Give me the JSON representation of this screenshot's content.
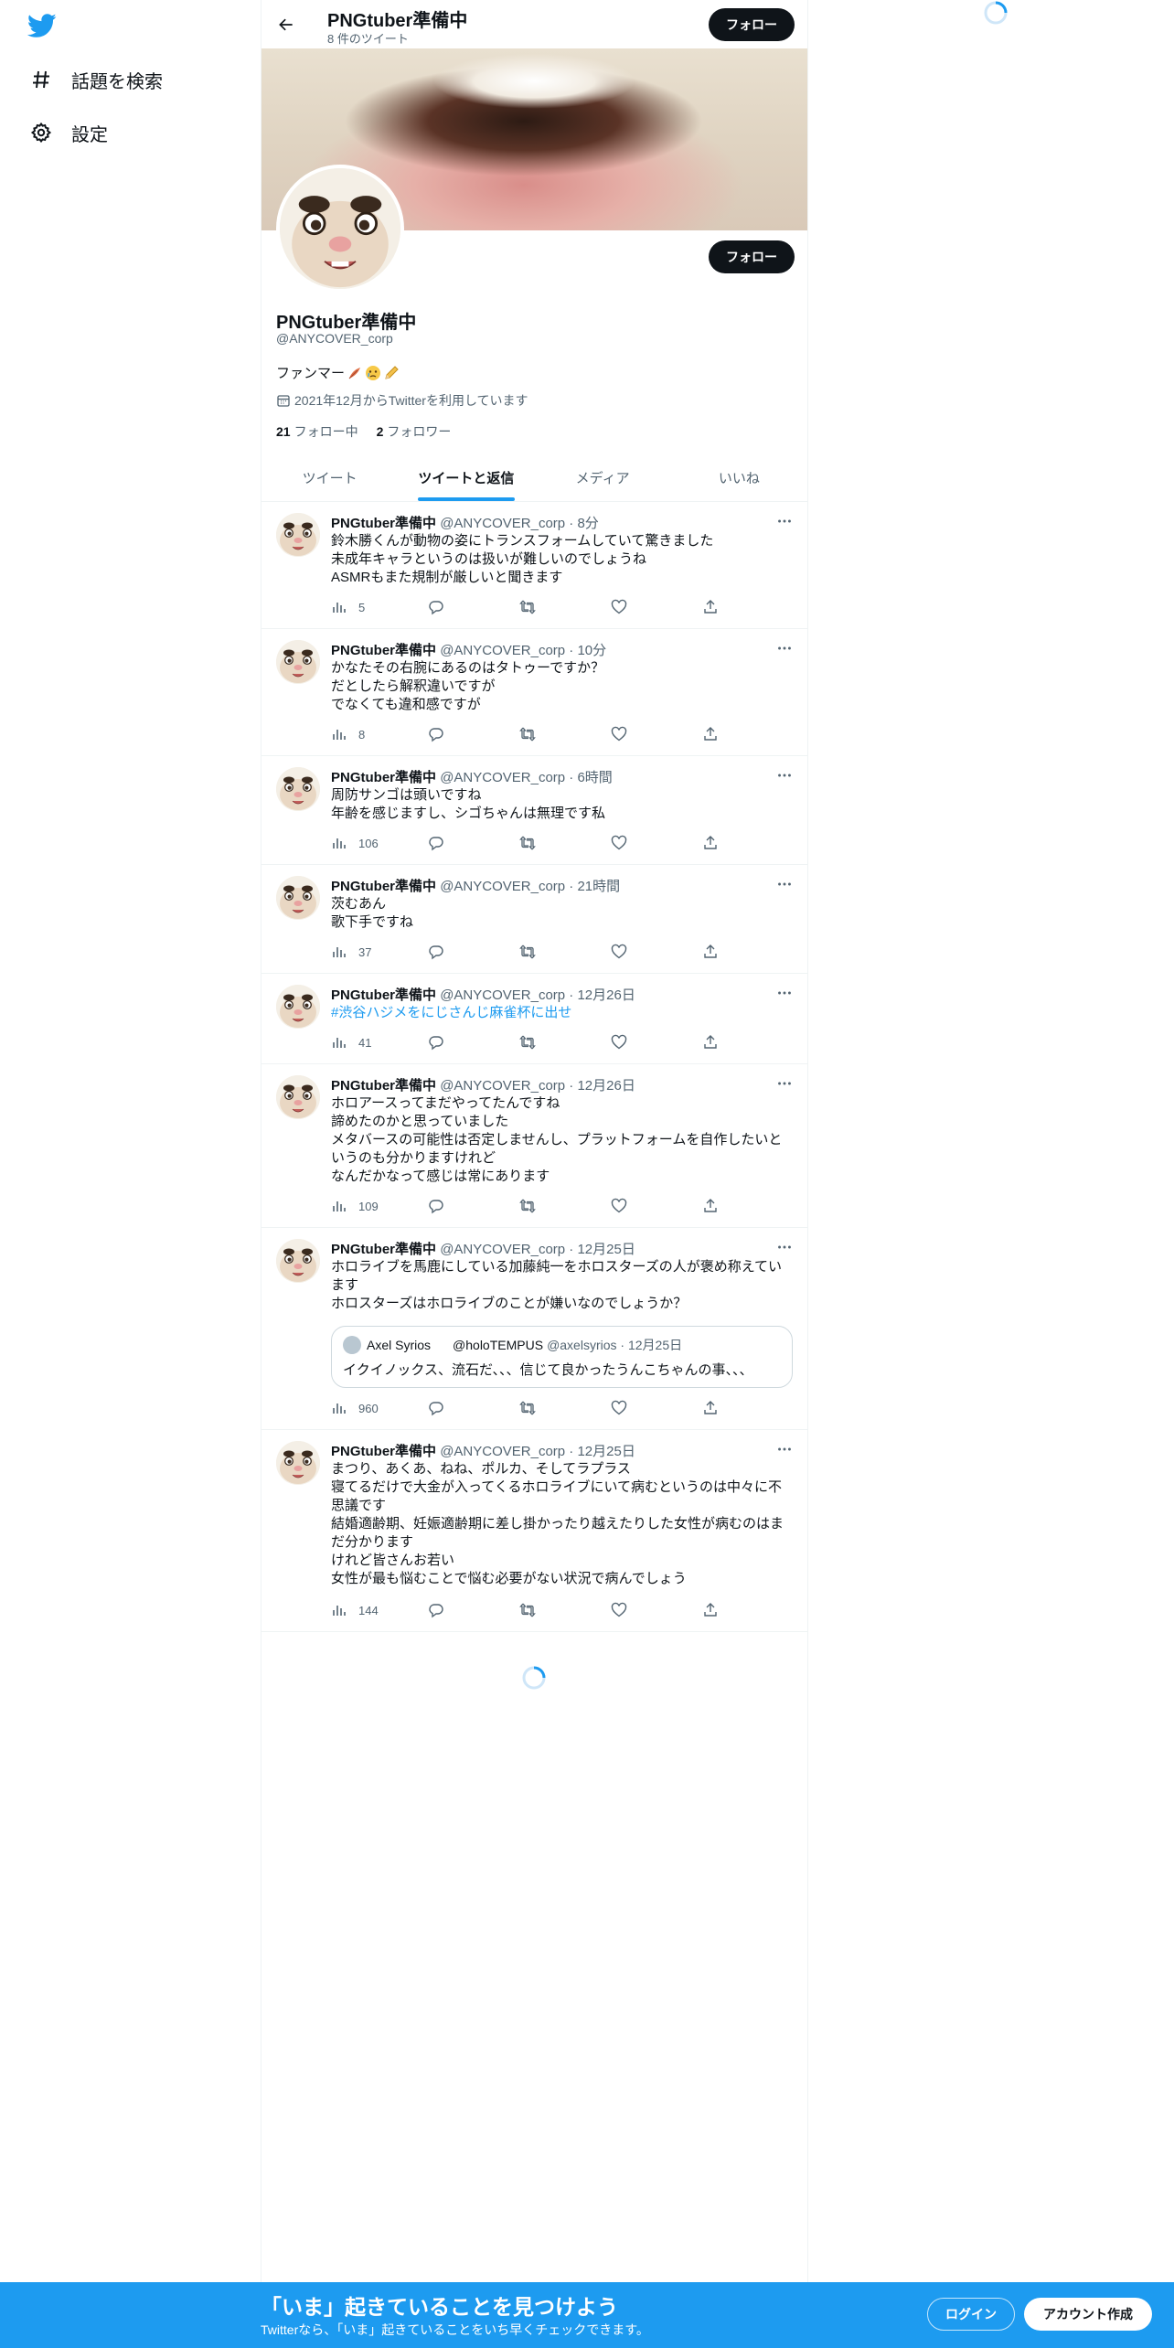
{
  "nav": {
    "items": [
      {
        "label": "話題を検索",
        "icon": "hashtag-icon"
      },
      {
        "label": "設定",
        "icon": "gear-icon"
      }
    ]
  },
  "header": {
    "title": "PNGtuber準備中",
    "subtitle": "8 件のツイート",
    "follow_label": "フォロー"
  },
  "profile": {
    "name": "PNGtuber準備中",
    "handle": "@ANYCOVER_corp",
    "bio": "ファンマー",
    "joined": "2021年12月からTwitterを利用しています",
    "following_count": "21",
    "following_label": "フォロー中",
    "followers_count": "2",
    "followers_label": "フォロワー",
    "follow_label": "フォロー"
  },
  "tabs": [
    {
      "label": "ツイート",
      "active": false
    },
    {
      "label": "ツイートと返信",
      "active": true
    },
    {
      "label": "メディア",
      "active": false
    },
    {
      "label": "いいね",
      "active": false
    }
  ],
  "tweets": [
    {
      "name": "PNGtuber準備中",
      "meta": "@ANYCOVER_corp · 8分",
      "lines": [
        "鈴木勝くんが動物の姿にトランスフォームしていて驚きました",
        "未成年キャラというのは扱いが難しいのでしょうね",
        "ASMRもまた規制が厳しいと聞きます"
      ],
      "views": "5"
    },
    {
      "name": "PNGtuber準備中",
      "meta": "@ANYCOVER_corp · 10分",
      "lines": [
        "かなたその右腕にあるのはタトゥーですか？",
        "だとしたら解釈違いですが",
        "でなくても違和感ですが"
      ],
      "views": "8"
    },
    {
      "name": "PNGtuber準備中",
      "meta": "@ANYCOVER_corp · 6時間",
      "lines": [
        "周防サンゴは頭いですね",
        "年齢を感じますし、シゴちゃんは無理です私"
      ],
      "views": "106"
    },
    {
      "name": "PNGtuber準備中",
      "meta": "@ANYCOVER_corp · 21時間",
      "lines": [
        "茨むあん",
        "歌下手ですね"
      ],
      "views": "37"
    },
    {
      "name": "PNGtuber準備中",
      "meta": "@ANYCOVER_corp · 12月26日",
      "lines": [
        "#渋谷ハジメをにじさんじ麻雀杯に出せ"
      ],
      "hashtag": true,
      "views": "41"
    },
    {
      "name": "PNGtuber準備中",
      "meta": "@ANYCOVER_corp · 12月26日",
      "lines": [
        "ホロアースってまだやってたんですね",
        "諦めたのかと思っていました",
        "メタバースの可能性は否定しませんし、プラットフォームを自作したいと",
        "いうのも分かりますけれど",
        "なんだかなって感じは常にあります"
      ],
      "views": "109"
    },
    {
      "name": "PNGtuber準備中",
      "meta": "@ANYCOVER_corp · 12月25日",
      "lines": [
        "ホロライブを馬鹿にしている加藤純一をホロスターズの人が褒め称えてい",
        "ます",
        "ホロスターズはホロライブのことが嫌いなのでしょうか？"
      ],
      "views": "960",
      "quote": {
        "name": "Axel Syrios",
        "name2": "@holoTEMPUS",
        "meta": "@axelsyrios · 12月25日",
        "text": "イクイノックス、流石だ、、、信じて良かったうんこちゃんの事、、、"
      }
    },
    {
      "name": "PNGtuber準備中",
      "meta": "@ANYCOVER_corp · 12月25日",
      "lines": [
        "まつり、あくあ、ねね、ポルカ、そしてラプラス",
        "寝てるだけで大金が入ってくるホロライブにいて病むというのは中々に不",
        "思議です",
        "結婚適齢期、妊娠適齢期に差し掛かったり越えたりした女性が病むのはま",
        "だ分かります",
        "けれど皆さんお若い",
        "女性が最も悩むことで悩む必要がない状況で病んでしょう"
      ],
      "views": "144"
    }
  ],
  "bottom": {
    "title": "「いま」起きていることを見つけよう",
    "subtitle": "Twitterなら、「いま」起きていることをいち早くチェックできます。",
    "login": "ログイン",
    "signup": "アカウント作成"
  },
  "colors": {
    "accent": "#1d9bf0",
    "text": "#0f1419",
    "muted": "#536471",
    "border": "#eff3f4"
  }
}
